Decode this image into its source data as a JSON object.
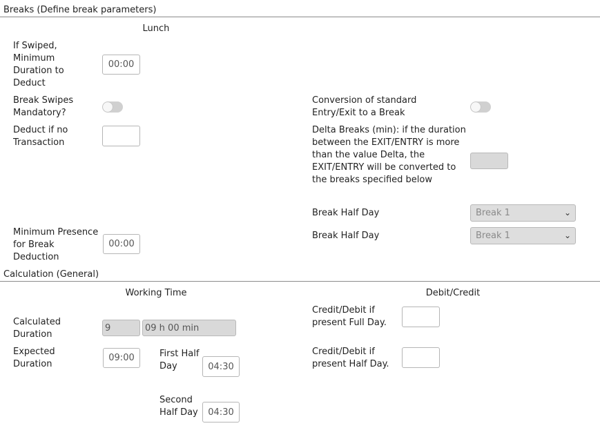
{
  "breaks": {
    "section_title": "Breaks (Define break parameters)",
    "lunch_header": "Lunch",
    "min_duration_label": "If Swiped, Minimum Duration to Deduct",
    "min_duration_value": "00:00",
    "swipes_mandatory_label": "Break Swipes Mandatory?",
    "swipes_mandatory_on": false,
    "deduct_no_transaction_label": "Deduct if no Transaction",
    "deduct_no_transaction_value": "",
    "conversion_label": "Conversion of standard Entry/Exit to a Break",
    "conversion_on": false,
    "delta_label": "Delta Breaks (min): if the duration between the EXIT/ENTRY is more than the value Delta, the EXIT/ENTRY will be converted to the breaks specified below",
    "delta_value": "",
    "half_day_label_1": "Break Half Day",
    "half_day_value_1": "Break 1",
    "half_day_label_2": "Break Half Day",
    "half_day_value_2": "Break 1",
    "min_presence_label": "Minimum Presence for Break Deduction",
    "min_presence_value": "00:00"
  },
  "calculation": {
    "section_title": "Calculation (General)",
    "working_time_header": "Working Time",
    "debit_credit_header": "Debit/Credit",
    "calculated_duration_label": "Calculated Duration",
    "calculated_hours_value": "9",
    "calculated_text_value": "09 h 00 min",
    "expected_duration_label": "Expected Duration",
    "expected_duration_value": "09:00",
    "first_half_label": "First Half Day",
    "first_half_value": "04:30",
    "second_half_label": "Second Half Day",
    "second_half_value": "04:30",
    "credit_full_label": "Credit/Debit if present Full Day.",
    "credit_full_value": "",
    "credit_half_label": "Credit/Debit if present Half Day.",
    "credit_half_value": ""
  },
  "colors": {
    "rule": "#8a8a8a",
    "toggle_off": "#d0d0d0",
    "disabled_bg": "#d9d9d9"
  }
}
